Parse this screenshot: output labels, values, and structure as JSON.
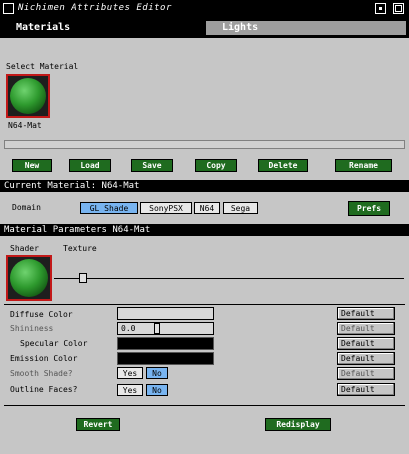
{
  "window": {
    "title": "Nichimen Attributes Editor"
  },
  "tabs": [
    {
      "label": "Materials"
    },
    {
      "label": "Lights"
    }
  ],
  "select_material": {
    "label": "Select Material",
    "items": [
      {
        "name": "N64-Mat"
      }
    ]
  },
  "toolbar": {
    "new_label": "New",
    "load_label": "Load",
    "save_label": "Save",
    "copy_label": "Copy",
    "delete_label": "Delete",
    "rename_label": "Rename"
  },
  "current_material": {
    "label": "Current Material: N64-Mat"
  },
  "domain": {
    "label": "Domain",
    "options": [
      "GL Shade",
      "SonyPSX",
      "N64",
      "Sega"
    ],
    "selected": "GL Shade",
    "prefs_label": "Prefs"
  },
  "params": {
    "header": "Material Parameters N64-Mat",
    "shader_label": "Shader",
    "texture_label": "Texture",
    "rows": {
      "diffuse": {
        "label": "Diffuse Color"
      },
      "shininess": {
        "label": "Shininess",
        "value": "0.0"
      },
      "specular": {
        "label": "Specular Color"
      },
      "emission": {
        "label": "Emission Color"
      },
      "smooth": {
        "label": "Smooth Shade?",
        "yes": "Yes",
        "no": "No",
        "selected": "No"
      },
      "outline": {
        "label": "Outline Faces?",
        "yes": "Yes",
        "no": "No",
        "selected": "No"
      }
    },
    "default_label": "Default"
  },
  "footer": {
    "revert_label": "Revert",
    "redisplay_label": "Redisplay"
  }
}
